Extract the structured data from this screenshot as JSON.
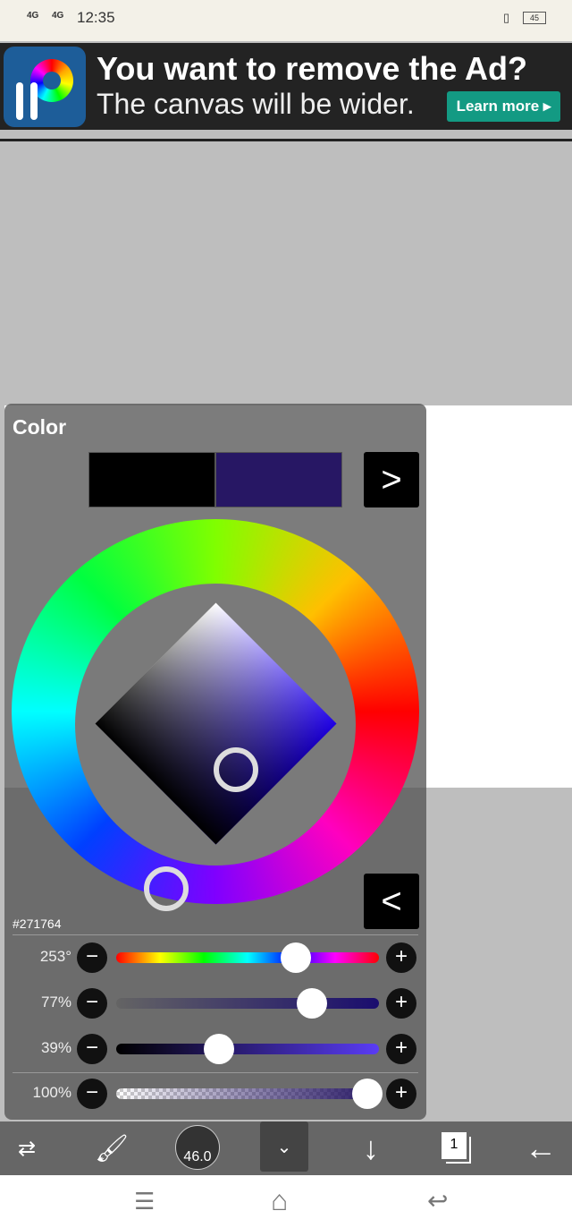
{
  "status": {
    "signal1": "4G",
    "signal2": "4G",
    "time": "12:35",
    "battery": "45"
  },
  "ad": {
    "headline": "You want to remove the Ad?",
    "subline": "The canvas will be wider.",
    "cta": "Learn more ▸",
    "logo_text": "iP"
  },
  "color_panel": {
    "title": "Color",
    "primary_color": "#000000",
    "secondary_color": "#271764",
    "next_label": ">",
    "prev_label": "<",
    "hex": "#271764",
    "sliders": [
      {
        "label": "253°",
        "name": "hue",
        "value": 253
      },
      {
        "label": "77%",
        "name": "saturation",
        "value": 77
      },
      {
        "label": "39%",
        "name": "brightness",
        "value": 39
      },
      {
        "label": "100%",
        "name": "opacity",
        "value": 100
      }
    ],
    "minus": "−",
    "plus": "+"
  },
  "toolbar": {
    "brush_size": "46.0",
    "layer_count": "1"
  },
  "nav": {
    "menu": "☰",
    "home": "⌂",
    "back": "↩"
  }
}
